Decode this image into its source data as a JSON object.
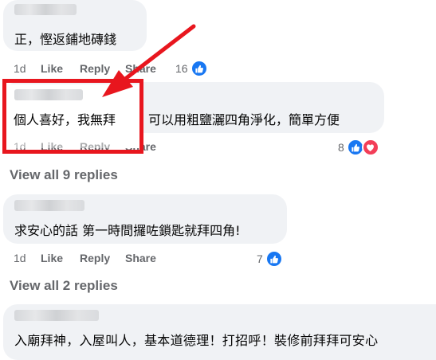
{
  "comments": [
    {
      "text": "正，慳返鋪地磚錢",
      "time": "1d",
      "like": "Like",
      "reply": "Reply",
      "share": "Share",
      "reaction_count": "16"
    },
    {
      "text_left": "個人喜好，我無拜",
      "text_right": "可以用粗鹽灑四角淨化，簡單方便",
      "time": "1d",
      "like": "Like",
      "reply": "Reply",
      "share": "Share",
      "reaction_count": "8"
    },
    {
      "text": "求安心的話 第一時間攞咗鎖匙就拜四角!",
      "time": "1d",
      "like": "Like",
      "reply": "Reply",
      "share": "Share",
      "reaction_count": "7"
    },
    {
      "text": "入廟拜神，入屋叫人，基本道德理！打招呼！裝修前拜拜可安心"
    }
  ],
  "view_replies_1": "View all 9 replies",
  "view_replies_2": "View all 2 replies",
  "icons": {
    "like": "like-icon",
    "love": "heart-icon",
    "arrow": "red-arrow-annotation"
  },
  "colors": {
    "facebook_blue": "#1877f2",
    "love_red": "#f33e58",
    "annotation_red": "#e8161e",
    "bubble_bg": "#f0f2f5"
  }
}
